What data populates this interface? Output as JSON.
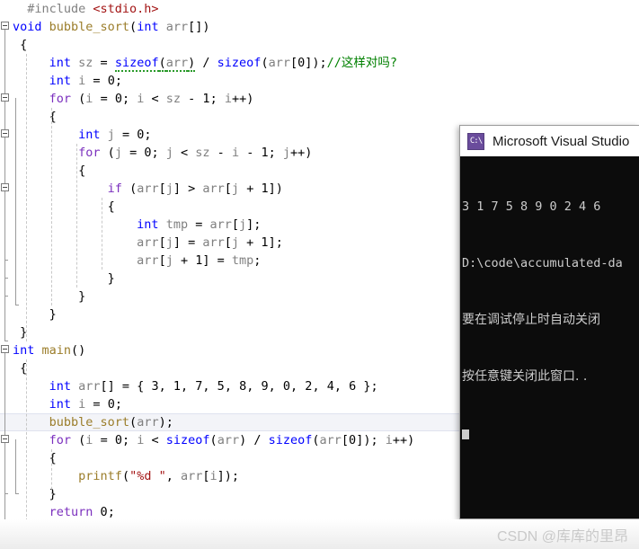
{
  "editor": {
    "language": "c",
    "current_line_index": 22,
    "colors": {
      "keyword": "#0000ff",
      "control_keyword": "#7b2fbe",
      "identifier": "#808080",
      "function": "#9b7d2a",
      "string": "#a31515",
      "comment": "#008000",
      "preprocessor": "#808080",
      "include_path": "#a31515",
      "background": "#ffffff",
      "current_line_highlight": "#f3f4f8"
    },
    "lines": [
      {
        "indent": 1,
        "text": "#include <stdio.h>"
      },
      {
        "indent": 0,
        "text": "void bubble_sort(int arr[])"
      },
      {
        "indent": 1,
        "text": "{"
      },
      {
        "indent": 2,
        "text": "int sz = sizeof(arr) / sizeof(arr[0]);//这样对吗?"
      },
      {
        "indent": 2,
        "text": "int i = 0;"
      },
      {
        "indent": 2,
        "text": "for (i = 0; i < sz - 1; i++)"
      },
      {
        "indent": 2,
        "text": "{"
      },
      {
        "indent": 3,
        "text": "int j = 0;"
      },
      {
        "indent": 3,
        "text": "for (j = 0; j < sz - i - 1; j++)"
      },
      {
        "indent": 3,
        "text": "{"
      },
      {
        "indent": 4,
        "text": "if (arr[j] > arr[j + 1])"
      },
      {
        "indent": 4,
        "text": "{"
      },
      {
        "indent": 5,
        "text": "int tmp = arr[j];"
      },
      {
        "indent": 5,
        "text": "arr[j] = arr[j + 1];"
      },
      {
        "indent": 5,
        "text": "arr[j + 1] = tmp;"
      },
      {
        "indent": 4,
        "text": "}"
      },
      {
        "indent": 3,
        "text": "}"
      },
      {
        "indent": 2,
        "text": "}"
      },
      {
        "indent": 1,
        "text": "}"
      },
      {
        "indent": 0,
        "text": "int main()"
      },
      {
        "indent": 1,
        "text": "{"
      },
      {
        "indent": 2,
        "text": "int arr[] = { 3, 1, 7, 5, 8, 9, 0, 2, 4, 6 };"
      },
      {
        "indent": 2,
        "text": "int i = 0;"
      },
      {
        "indent": 2,
        "text": "bubble_sort(arr);"
      },
      {
        "indent": 2,
        "text": "for (i = 0; i < sizeof(arr) / sizeof(arr[0]); i++)"
      },
      {
        "indent": 2,
        "text": "{"
      },
      {
        "indent": 3,
        "text": "printf(\"%d \", arr[i]);"
      },
      {
        "indent": 2,
        "text": "}"
      },
      {
        "indent": 2,
        "text": "return 0;"
      },
      {
        "indent": 1,
        "text": "}"
      }
    ],
    "fold_marker_lines": [
      1,
      5,
      8,
      10,
      19,
      24
    ],
    "squiggle_token": "sizeof(arr)",
    "comment_text": "//这样对吗?"
  },
  "console": {
    "icon": "console-window-icon",
    "icon_glyph": "C:\\",
    "title": "Microsoft Visual Studio",
    "output_lines": [
      "3 1 7 5 8 9 0 2 4 6",
      "D:\\code\\accumulated-da",
      "要在调试停止时自动关闭",
      "按任意键关闭此窗口. ."
    ],
    "background": "#0c0c0c",
    "text_color": "#cccccc"
  },
  "watermark": {
    "text": "CSDN @库库的里昂"
  }
}
